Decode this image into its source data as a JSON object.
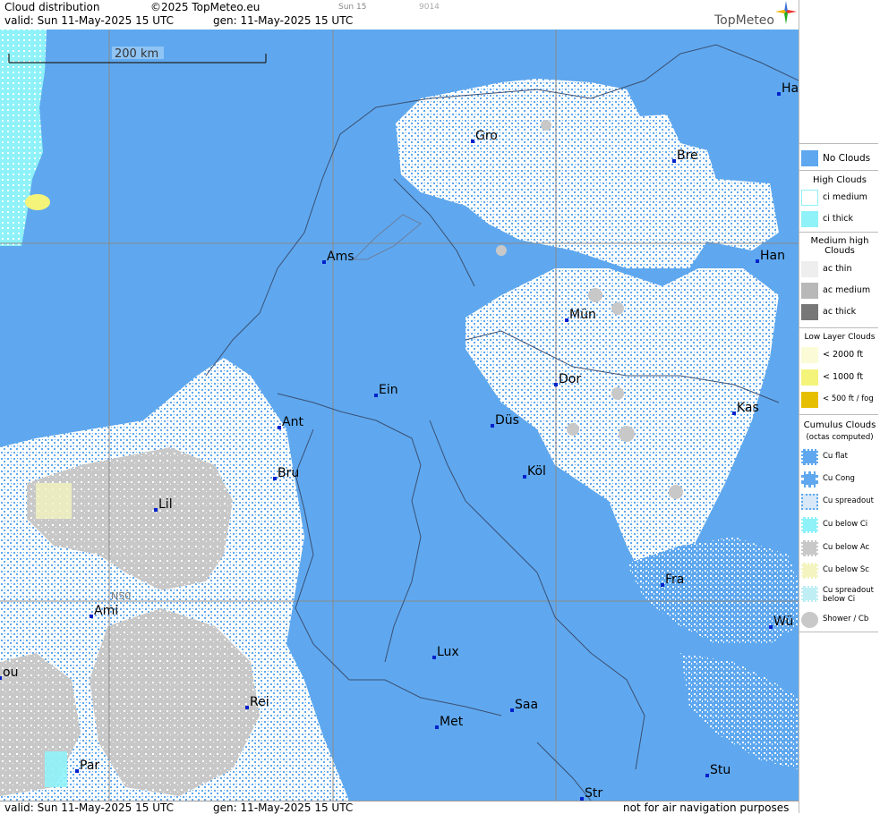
{
  "header": {
    "title": "Cloud distribution",
    "copyright": "©2025 TopMeteo.eu",
    "small1": "Sun 15",
    "small2": "9014",
    "valid": "valid:  Sun  11-May-2025  15 UTC",
    "gen": "gen: 11-May-2025 15 UTC",
    "logo": "TopMeteo"
  },
  "footer": {
    "valid": "valid:  Sun  11-May-2025  15 UTC",
    "gen": "gen: 11-May-2025 15 UTC",
    "disclaimer": "not for air navigation purposes"
  },
  "map": {
    "scale_label": "200 km",
    "lat_label": "N50",
    "cities": [
      {
        "name": "Gro"
      },
      {
        "name": "Bre"
      },
      {
        "name": "Ha"
      },
      {
        "name": "Ams"
      },
      {
        "name": "Han"
      },
      {
        "name": "Mün"
      },
      {
        "name": "Ein"
      },
      {
        "name": "Dor"
      },
      {
        "name": "Kas"
      },
      {
        "name": "Ant"
      },
      {
        "name": "Düs"
      },
      {
        "name": "Bru"
      },
      {
        "name": "Köl"
      },
      {
        "name": "Lil"
      },
      {
        "name": "Fra"
      },
      {
        "name": "Ami"
      },
      {
        "name": "Wü"
      },
      {
        "name": "Lux"
      },
      {
        "name": "ou"
      },
      {
        "name": "Rei"
      },
      {
        "name": "Saa"
      },
      {
        "name": "Met"
      },
      {
        "name": "Par"
      },
      {
        "name": "Stu"
      },
      {
        "name": "Str"
      }
    ]
  },
  "legend": {
    "no_clouds": "No Clouds",
    "high_title": "High Clouds",
    "ci_medium": "ci medium",
    "ci_thick": "ci thick",
    "medium_title": "Medium high Clouds",
    "ac_thin": "ac thin",
    "ac_medium": "ac medium",
    "ac_thick": "ac thick",
    "low_title": "Low Layer Clouds",
    "low1": "< 2000 ft",
    "low2": "< 1000 ft",
    "low3": "< 500 ft / fog",
    "cu_title": "Cumulus Clouds",
    "cu_sub": "(octas computed)",
    "cu_flat": "Cu flat",
    "cu_cong": "Cu Cong",
    "cu_spread": "Cu spreadout",
    "cu_below_ci": "Cu below Ci",
    "cu_below_ac": "Cu below Ac",
    "cu_below_sc": "Cu below Sc",
    "cu_spread_ci": "Cu spreadout below Ci",
    "shower": "Shower / Cb"
  },
  "colors": {
    "no_clouds": "#5fa8ef",
    "ci": "#8ef2f8",
    "cu": "#ffffff",
    "ac": "#c4c4c4",
    "low": "#f4f47a"
  }
}
